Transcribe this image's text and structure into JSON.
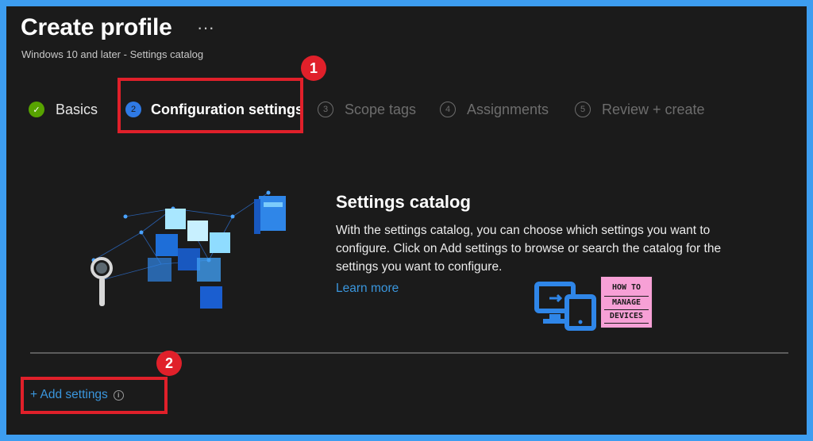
{
  "header": {
    "title": "Create profile",
    "more": "···",
    "subtitle": "Windows 10 and later - Settings catalog"
  },
  "steps": [
    {
      "number": "✓",
      "label": "Basics",
      "state": "done"
    },
    {
      "number": "2",
      "label": "Configuration settings",
      "state": "active"
    },
    {
      "number": "3",
      "label": "Scope tags",
      "state": "pending"
    },
    {
      "number": "4",
      "label": "Assignments",
      "state": "pending"
    },
    {
      "number": "5",
      "label": "Review + create",
      "state": "pending"
    }
  ],
  "callouts": {
    "one": "1",
    "two": "2"
  },
  "catalog": {
    "title": "Settings catalog",
    "description": "With the settings catalog, you can choose which settings you want to configure. Click on Add settings to browse or search the catalog for the settings you want to configure.",
    "learn_more": "Learn more"
  },
  "actions": {
    "add_settings": "+ Add settings",
    "info_icon": "i"
  },
  "watermark": {
    "line1": "HOW TO",
    "line2": "MANAGE",
    "line3": "DEVICES"
  },
  "colors": {
    "accent": "#3a96dd",
    "highlight": "#e0202a",
    "success": "#57a300",
    "background": "#1b1b1b"
  }
}
